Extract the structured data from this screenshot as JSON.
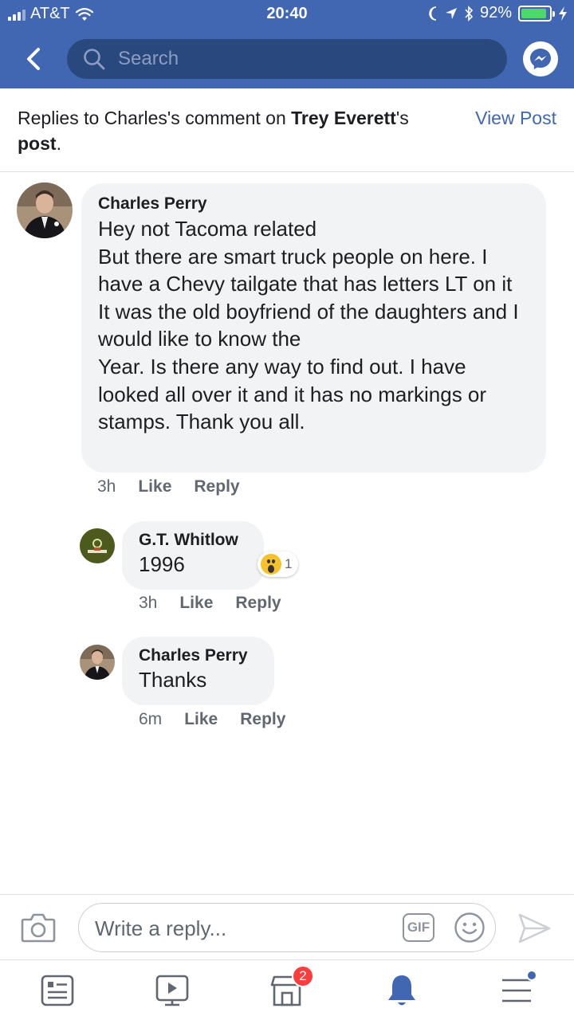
{
  "status_bar": {
    "carrier": "AT&T",
    "time": "20:40",
    "battery": "92%",
    "battery_level": 0.92,
    "icons": [
      "signal-icon",
      "wifi-icon",
      "moon-icon",
      "location-icon",
      "bluetooth-icon",
      "battery-icon",
      "charging-icon"
    ]
  },
  "nav": {
    "back_icon": "chevron-left-icon",
    "search_placeholder": "Search",
    "messenger_icon": "messenger-icon"
  },
  "context": {
    "prefix": "Replies to Charles's comment on ",
    "author": "Trey Everett",
    "middle": "'s ",
    "post_word": "post",
    "suffix": ".",
    "view_post": "View Post"
  },
  "comments": [
    {
      "name": "Charles Perry",
      "body": "Hey not Tacoma related\nBut there are smart truck people on here. I have a Chevy tailgate that has letters LT on it\nIt was the old boyfriend of the daughters and I would like to know the\nYear. Is there any way to find out. I have looked all over it and it has no markings or stamps. Thank you all.",
      "time": "3h",
      "like": "Like",
      "reply": "Reply"
    },
    {
      "name": "G.T. Whitlow",
      "body": "1996",
      "time": "3h",
      "like": "Like",
      "reply": "Reply",
      "reaction_icon": "wow-reaction-icon",
      "reaction_count": "1"
    },
    {
      "name": "Charles Perry",
      "body": "Thanks",
      "time": "6m",
      "like": "Like",
      "reply": "Reply"
    }
  ],
  "composer": {
    "placeholder": "Write a reply...",
    "gif_label": "GIF",
    "icons": [
      "camera-icon",
      "gif-icon",
      "smiley-icon",
      "send-icon"
    ]
  },
  "tabbar": {
    "tabs": [
      "news-feed-icon",
      "watch-icon",
      "marketplace-icon",
      "notifications-icon",
      "menu-icon"
    ],
    "marketplace_badge": "2"
  },
  "colors": {
    "brand": "#4267b2",
    "search_bg": "#29487d",
    "bubble": "#f2f3f5",
    "link": "#4267b2",
    "badge": "#fa3e3e"
  }
}
